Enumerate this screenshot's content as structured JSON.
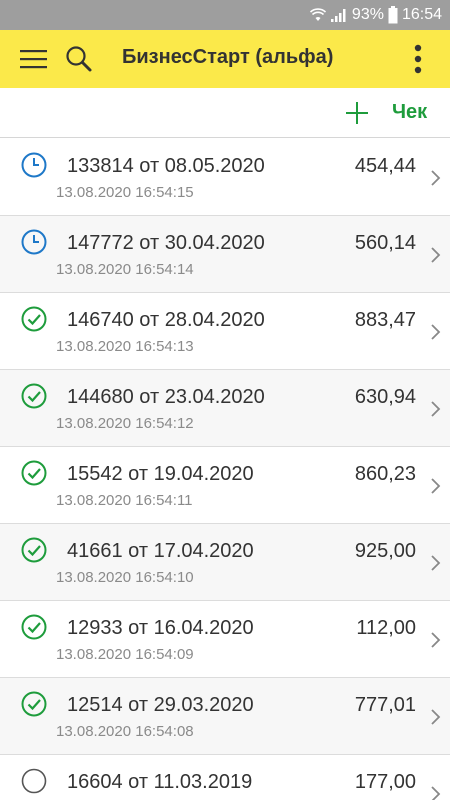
{
  "status_bar": {
    "battery": "93%",
    "time": "16:54"
  },
  "app_bar": {
    "title": "БизнесСтарт (альфа)"
  },
  "toolbar": {
    "check_label": "Чек"
  },
  "colors": {
    "app_bar": "#fbe94a",
    "accent_green": "#1e9c3c",
    "pending_blue": "#1e78c8"
  },
  "receipts": [
    {
      "title": "133814 от 08.05.2020",
      "time": "13.08.2020 16:54:15",
      "amount": "454,44",
      "status": "clock-icon"
    },
    {
      "title": "147772 от 30.04.2020",
      "time": "13.08.2020 16:54:14",
      "amount": "560,14",
      "status": "clock-icon"
    },
    {
      "title": "146740 от 28.04.2020",
      "time": "13.08.2020 16:54:13",
      "amount": "883,47",
      "status": "check-circle-icon"
    },
    {
      "title": "144680 от 23.04.2020",
      "time": "13.08.2020 16:54:12",
      "amount": "630,94",
      "status": "check-circle-icon"
    },
    {
      "title": "15542 от 19.04.2020",
      "time": "13.08.2020 16:54:11",
      "amount": "860,23",
      "status": "check-circle-icon"
    },
    {
      "title": "41661 от 17.04.2020",
      "time": "13.08.2020 16:54:10",
      "amount": "925,00",
      "status": "check-circle-icon"
    },
    {
      "title": "12933 от 16.04.2020",
      "time": "13.08.2020 16:54:09",
      "amount": "112,00",
      "status": "check-circle-icon"
    },
    {
      "title": "12514 от 29.03.2020",
      "time": "13.08.2020 16:54:08",
      "amount": "777,01",
      "status": "check-circle-icon"
    },
    {
      "title": "16604 от 11.03.2019",
      "time": "",
      "amount": "177,00",
      "status": "empty-circle-icon"
    }
  ]
}
